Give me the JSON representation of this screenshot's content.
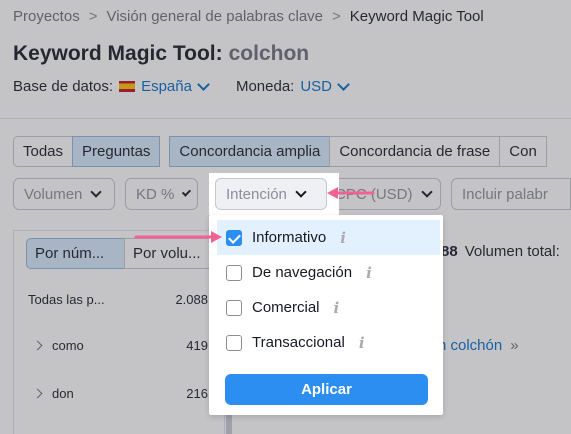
{
  "breadcrumb": {
    "items": [
      "Proyectos",
      "Visión general de palabras clave",
      "Keyword Magic Tool"
    ],
    "separator": ">"
  },
  "title": {
    "tool": "Keyword Magic Tool:",
    "keyword": "colchon"
  },
  "meta": {
    "database_label": "Base de datos:",
    "database_value": "España",
    "currency_label": "Moneda:",
    "currency_value": "USD"
  },
  "match_tabs": {
    "group1": [
      "Todas",
      "Preguntas"
    ],
    "group2": [
      "Concordancia amplia",
      "Concordancia de frase",
      "Con"
    ],
    "active": [
      "Preguntas",
      "Concordancia amplia"
    ]
  },
  "filters": {
    "volume": "Volumen",
    "kd": "KD %",
    "intent": "Intención",
    "cpc": "CPC (USD)",
    "include": "Incluir palabr"
  },
  "left_panel": {
    "sort_by_number": "Por núm...",
    "sort_by_volume": "Por volu...",
    "all_label": "Todas las p...",
    "all_count": "2.088",
    "groups": [
      {
        "name": "como",
        "count": "419"
      },
      {
        "name": "don",
        "count": "216"
      }
    ]
  },
  "results": {
    "count_fragment": "88",
    "total_volume_label": "Volumen total:",
    "link_fragment": "n colchón",
    "link_arrows": "»"
  },
  "intent_dropdown": {
    "options": [
      {
        "label": "Informativo",
        "checked": true
      },
      {
        "label": "De navegación",
        "checked": false
      },
      {
        "label": "Comercial",
        "checked": false
      },
      {
        "label": "Transaccional",
        "checked": false
      }
    ],
    "info_icon": "i",
    "apply_label": "Aplicar"
  },
  "colors": {
    "accent": "#2b8ef0",
    "link": "#006dca",
    "annotation_arrow": "#f06292"
  }
}
